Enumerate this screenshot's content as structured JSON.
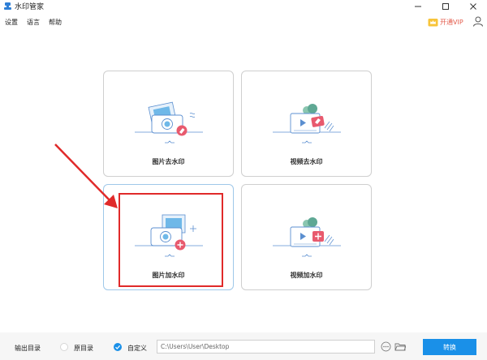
{
  "window": {
    "title": "水印管家",
    "controls": [
      "minimize-icon",
      "maximize-icon",
      "close-icon"
    ]
  },
  "menu": {
    "items": [
      {
        "label": "设置"
      },
      {
        "label": "语言"
      },
      {
        "label": "帮助"
      }
    ],
    "vip_label": "开通VIP",
    "icons": {
      "vip": "crown-icon",
      "user": "user-icon"
    }
  },
  "cards": [
    {
      "label": "图片去水印",
      "icon": "photo-remove-watermark-icon"
    },
    {
      "label": "视频去水印",
      "icon": "video-remove-watermark-icon"
    },
    {
      "label": "图片加水印",
      "icon": "photo-add-watermark-icon",
      "selected": true
    },
    {
      "label": "视频加水印",
      "icon": "video-add-watermark-icon"
    }
  ],
  "bottom": {
    "output_label": "输出目录",
    "option_original": "原目录",
    "option_custom": "自定义",
    "selected_option": "自定义",
    "path_value": "C:\\Users\\User\\Desktop",
    "convert_label": "转换"
  },
  "colors": {
    "accent": "#1a90e8",
    "annotation": "#e02a2a",
    "vip_text": "#e35b4b"
  }
}
